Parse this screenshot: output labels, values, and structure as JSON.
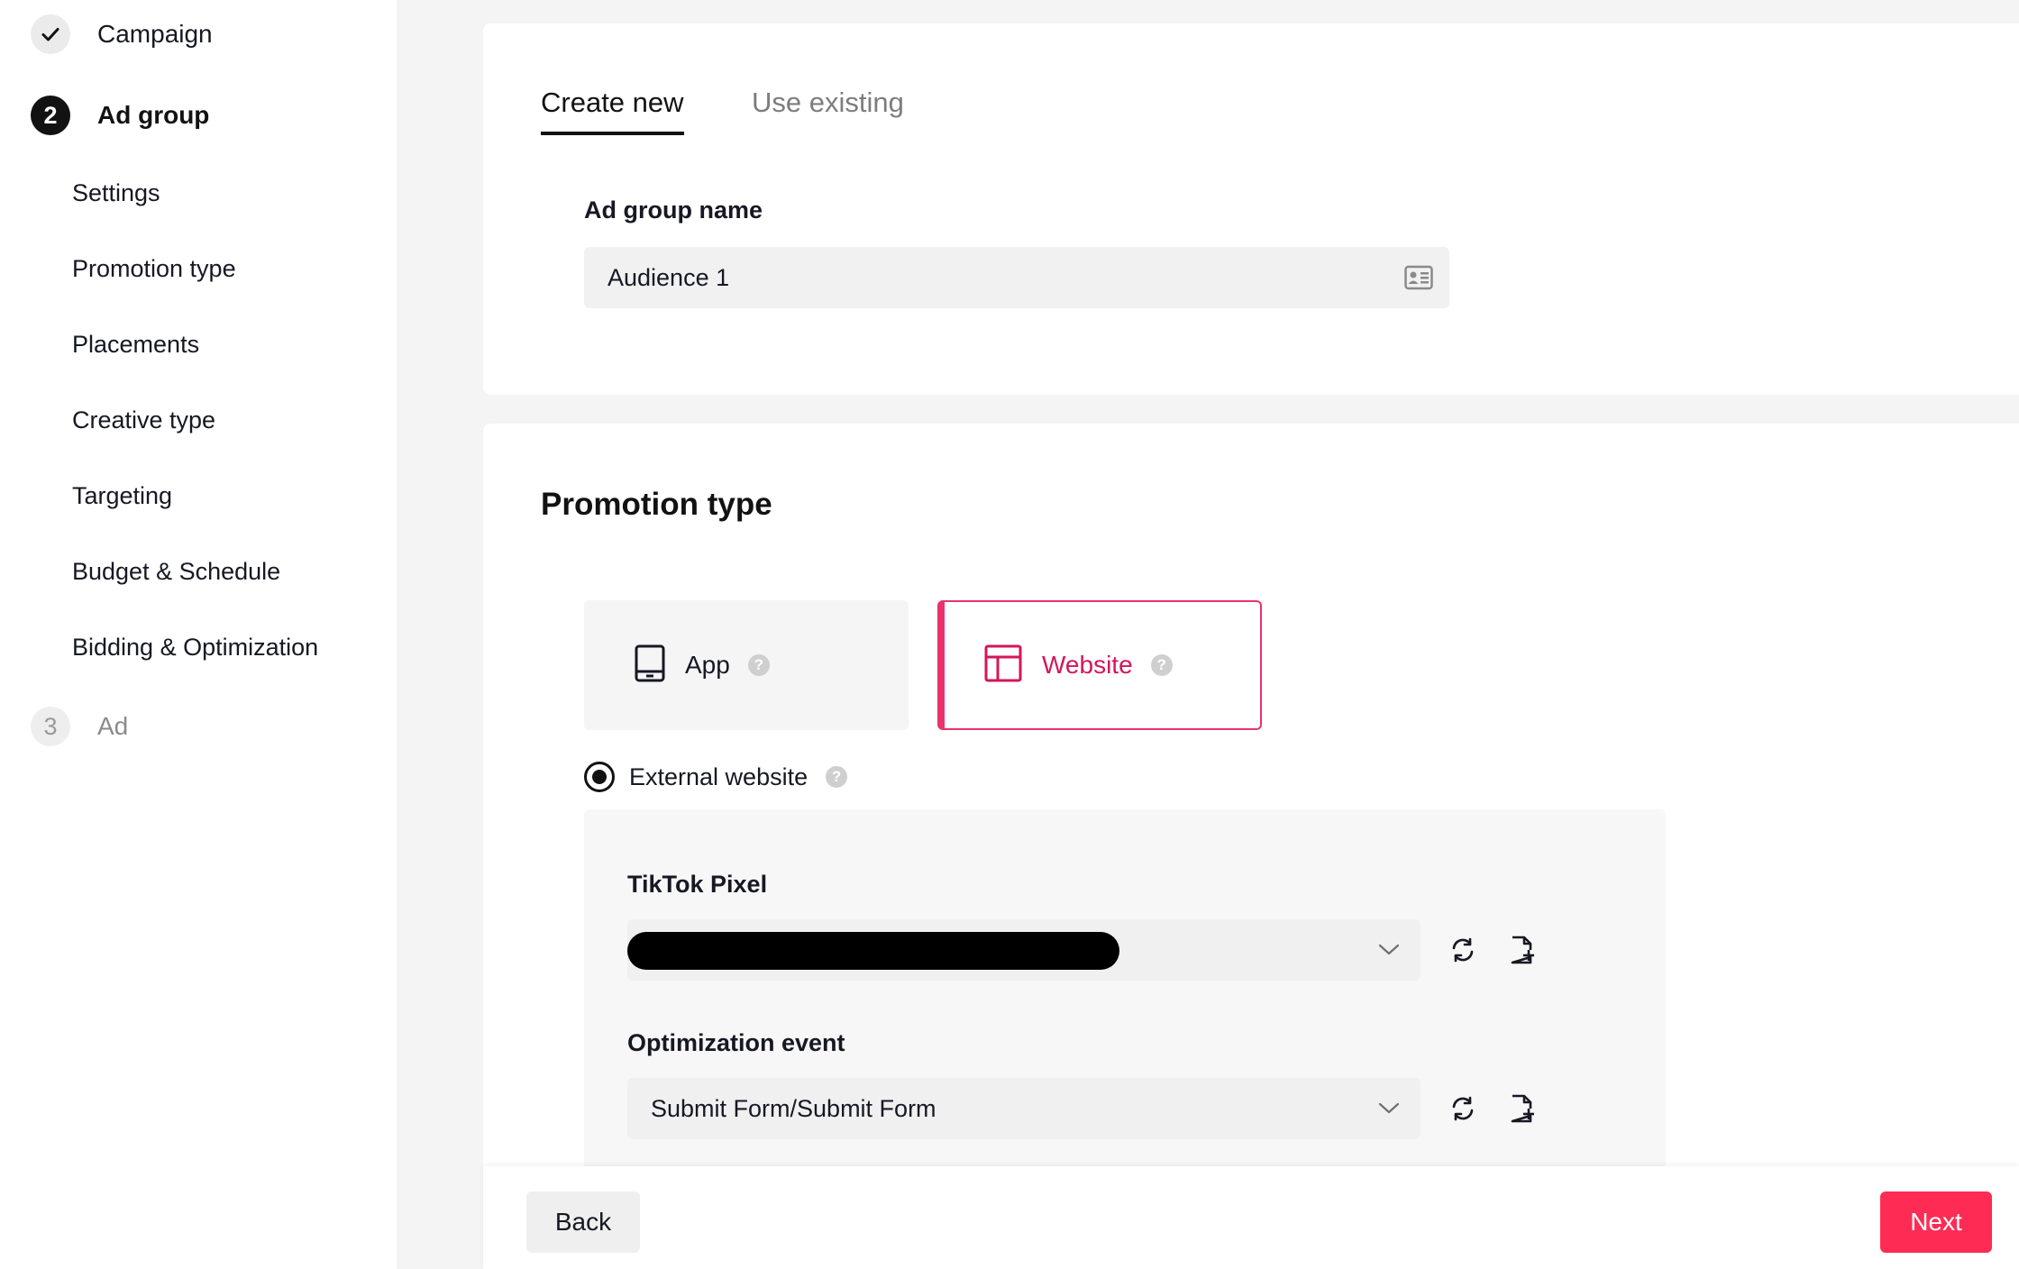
{
  "sidebar": {
    "steps": [
      {
        "number": "",
        "label": "Campaign",
        "state": "done"
      },
      {
        "number": "2",
        "label": "Ad group",
        "state": "active"
      },
      {
        "number": "3",
        "label": "Ad",
        "state": "pending"
      }
    ],
    "substeps": [
      "Settings",
      "Promotion type",
      "Placements",
      "Creative type",
      "Targeting",
      "Budget & Schedule",
      "Bidding & Optimization"
    ]
  },
  "ad_group_card": {
    "tabs": [
      {
        "label": "Create new",
        "active": true
      },
      {
        "label": "Use existing",
        "active": false
      }
    ],
    "name_label": "Ad group name",
    "name_value": "Audience 1"
  },
  "promotion_card": {
    "title": "Promotion type",
    "options": [
      {
        "label": "App",
        "icon": "tablet-icon",
        "selected": false
      },
      {
        "label": "Website",
        "icon": "layout-icon",
        "selected": true
      }
    ],
    "radio_label": "External website",
    "pixel_label": "TikTok Pixel",
    "optimization_label": "Optimization event",
    "optimization_value": "Submit Form/Submit Form"
  },
  "footer": {
    "back_label": "Back",
    "next_label": "Next"
  },
  "colors": {
    "accent": "#fe2c55",
    "selected_border": "#e8336b",
    "selected_text": "#d3165a",
    "text": "#161823"
  }
}
